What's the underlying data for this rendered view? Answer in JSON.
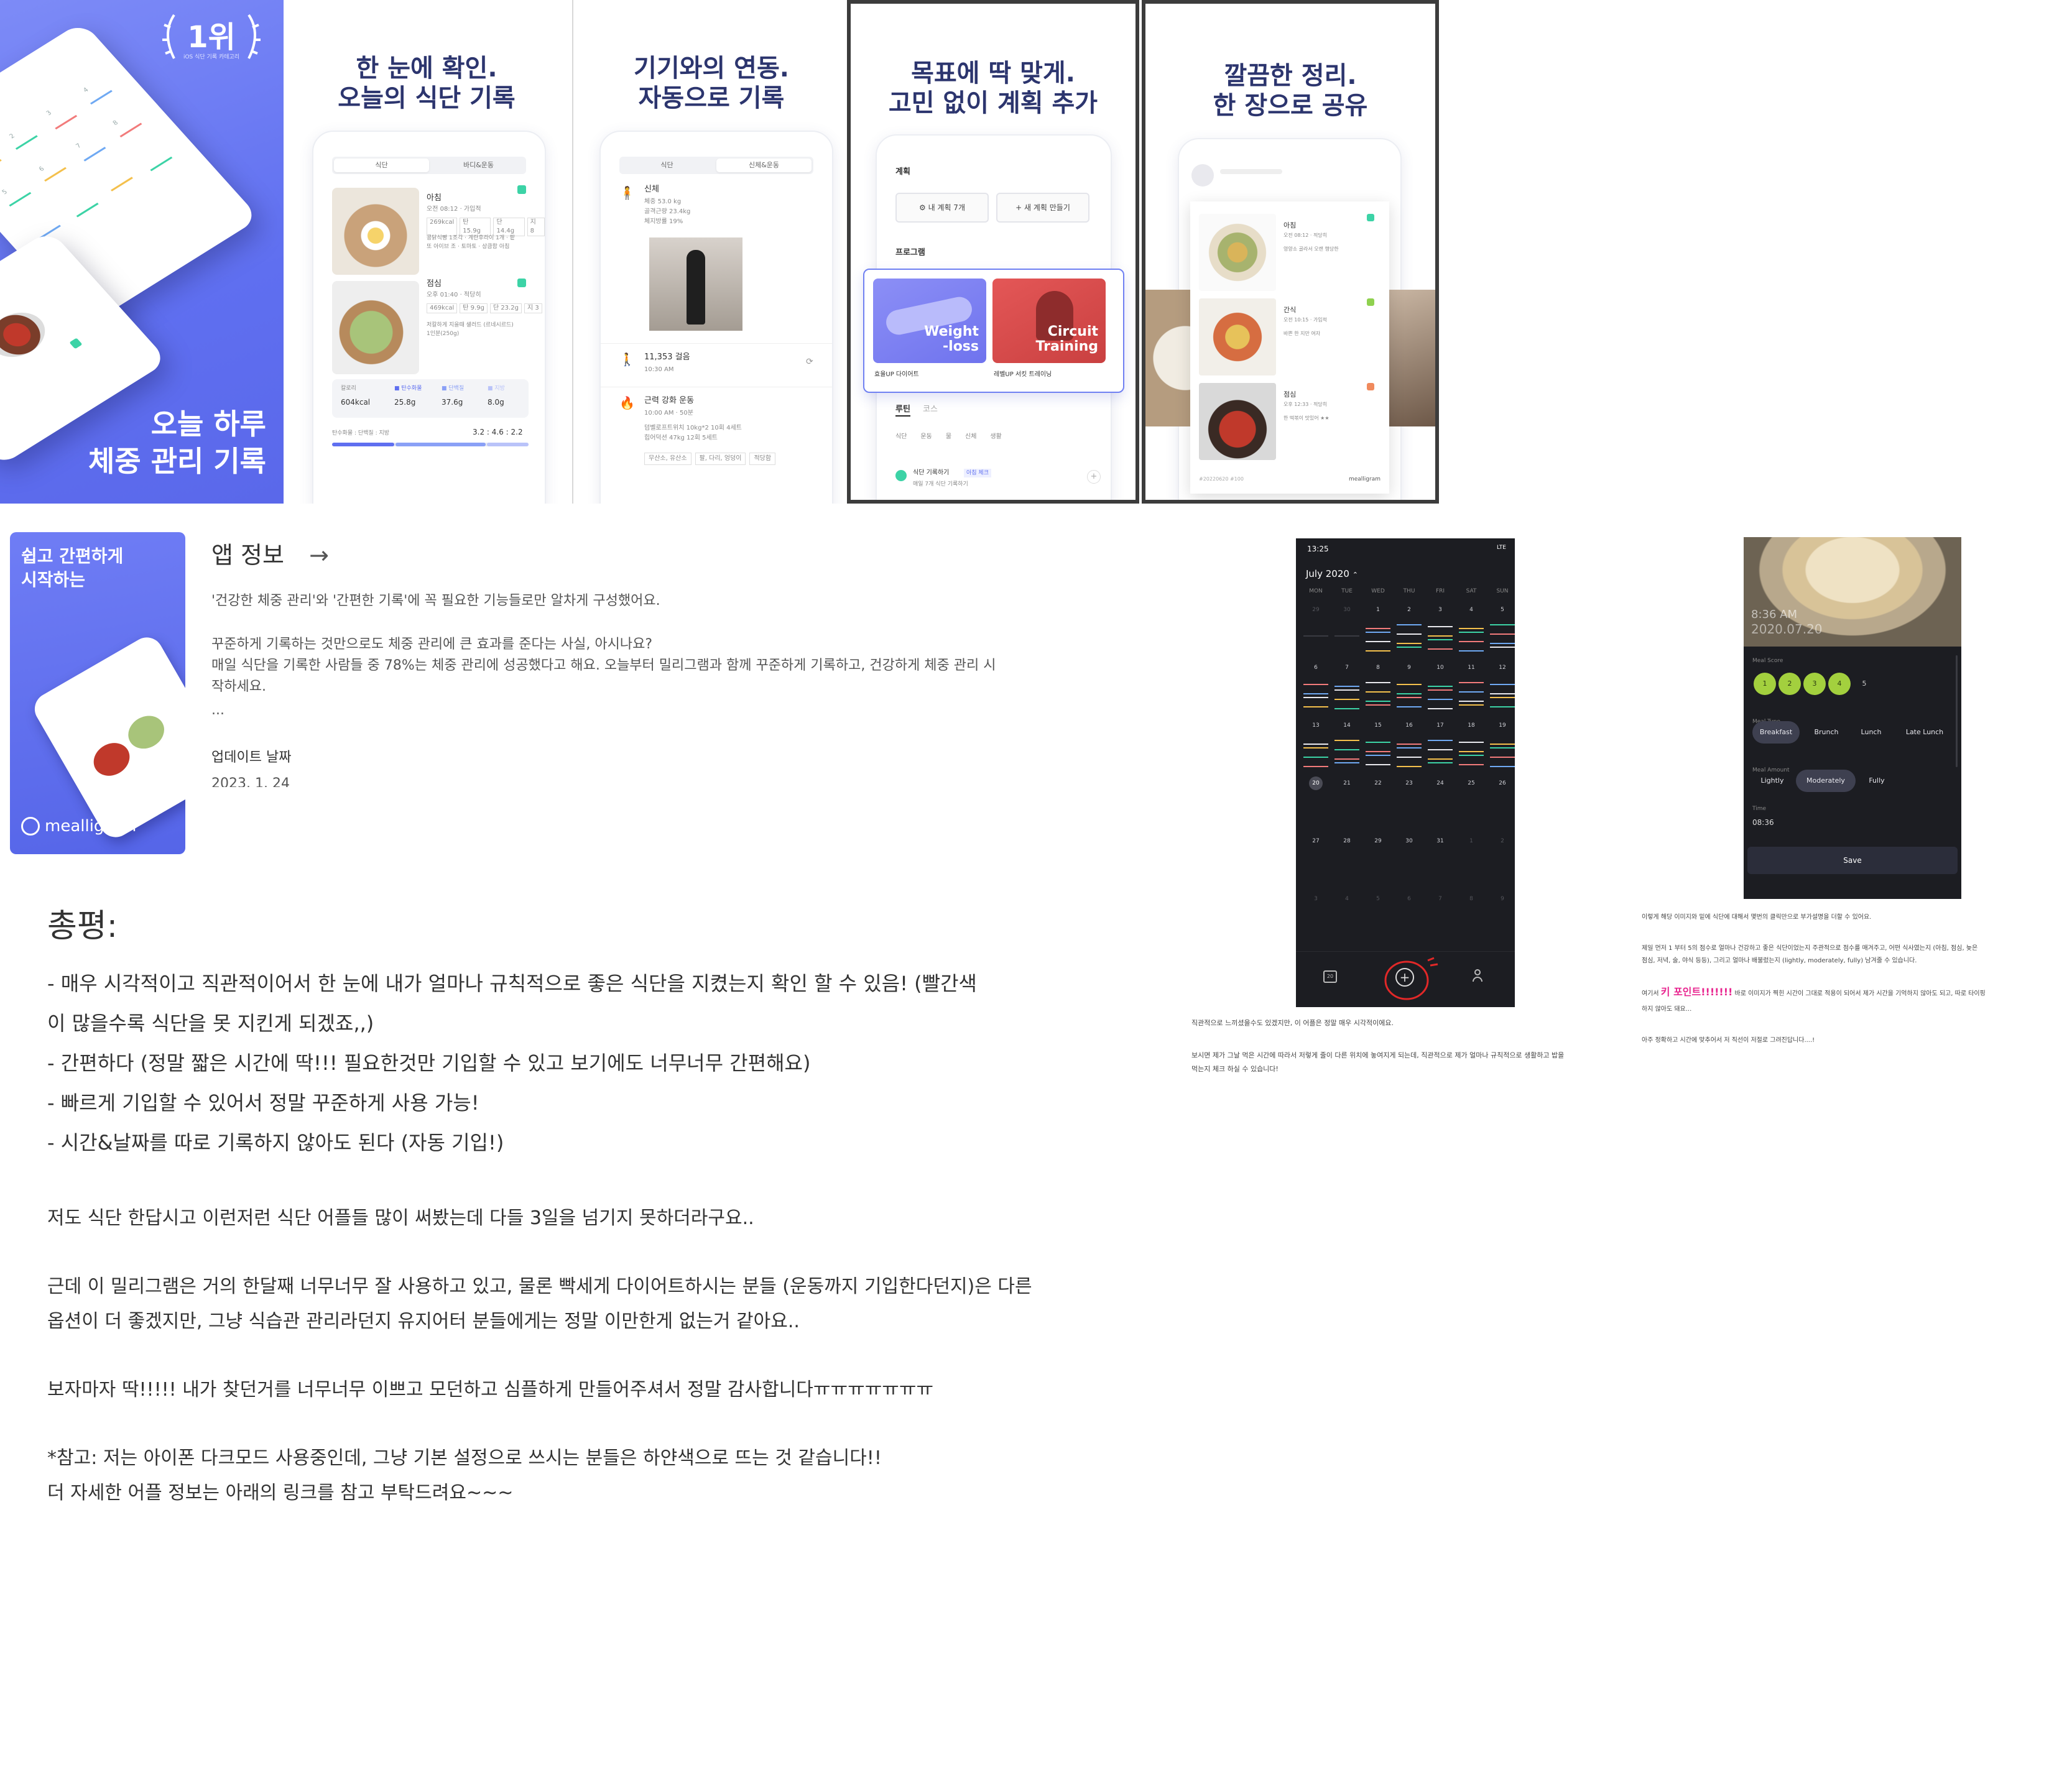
{
  "store": {
    "banner1": {
      "badge": "1위",
      "badge_sub": "iOS 식단 기록 카테고리",
      "title": "오늘 하루\n체중 관리 기록"
    },
    "banner2": {
      "title": "한 눈에 확인.\n오늘의 식단 기록",
      "tabs": [
        "식단",
        "바디&운동"
      ],
      "meal1": {
        "name": "아침",
        "time": "오전 08:12 · 가입적",
        "tags": [
          "269kcal",
          "탄 15.9g",
          "단 14.4g",
          "지 8"
        ],
        "memo": "콩닭식빵 1조각 · 계란후라이 1개 · 팥\n또 아이브 조 · 토마토 · 상큼함 아침"
      },
      "meal2": {
        "name": "점심",
        "time": "오후 01:40 · 적당히",
        "tags": [
          "469kcal",
          "탄 9.9g",
          "단 23.2g",
          "지 3"
        ],
        "memo": "저칼하게 지을때 샐러드 (르네시르드)\n1인분(250g)"
      },
      "kpis": [
        {
          "label": "칼로리",
          "value": "604kcal"
        },
        {
          "label": "■ 탄수화물",
          "value": "25.8g"
        },
        {
          "label": "■ 단백질",
          "value": "37.6g"
        },
        {
          "label": "■ 지방",
          "value": "8.0g"
        }
      ],
      "ratio_label": "탄수화물 : 단백질 : 지방",
      "ratio_value": "3.2 : 4.6 : 2.2"
    },
    "banner3": {
      "title": "기기와의 연동.\n자동으로 기록",
      "tabs": [
        "식단",
        "신체&운동"
      ],
      "body": {
        "name": "신체",
        "lines": [
          "체중 53.0 kg",
          "골격근량 23.4kg",
          "체지방률 19%"
        ]
      },
      "steps": {
        "name": "11,353 걸음",
        "time": "10:30 AM"
      },
      "workout": {
        "name": "근력 강화 운동",
        "time": "10:00 AM · 50분",
        "lines": [
          "덤벨로프트위치 10kg*2 10회 4세트",
          "힙어덕션 47kg 12회 5세트"
        ],
        "tags": [
          "무산소, 유산소",
          "팔, 다리, 엉덩이",
          "적당함"
        ]
      }
    },
    "banner4": {
      "title": "목표에 딱 맞게.\n고민 없이 계획 추가",
      "plan_heading": "계획",
      "buttons": [
        "내 계획 7개",
        "새 계획 만들기"
      ],
      "program_heading": "프로그램",
      "programs": [
        {
          "img_text": "Weight\n-loss",
          "caption": "효율UP 다이어트"
        },
        {
          "img_text": "Circuit\nTraining",
          "caption": "레벨UP 서킷 트레이닝"
        }
      ],
      "routine_tabs": [
        "루틴",
        "코스"
      ],
      "routine_chips": [
        "식단",
        "운동",
        "물",
        "신체",
        "생활"
      ],
      "routine_item": "식단 기록하기",
      "routine_badge": "아침 체크",
      "routine_sub": "매일 7개 식단 기록하기"
    },
    "banner5": {
      "title": "깔끔한 정리.\n한 장으로 공유",
      "meals": [
        {
          "name": "아침",
          "time": "오전 08:12 · 적당히",
          "memo": "영양소 골라서 오랜 행당한"
        },
        {
          "name": "간식",
          "time": "오전 10:15 · 가입적",
          "memo": "바쁜 한 지만 여자"
        },
        {
          "name": "점심",
          "time": "오후 12:33 · 적당히",
          "memo": "한 떡볶이 맛있어 ★★"
        }
      ],
      "footer_date": "#20220620 #100",
      "footer_logo": "mealligram"
    }
  },
  "appinfo": {
    "icon_tagline": "쉽고 간편하게\n시작하는",
    "icon_logo": "mealligram",
    "title": "앱 정보",
    "arrow": "→",
    "p1": "'건강한 체중 관리'와 '간편한 기록'에 꼭 필요한 기능들로만 알차게 구성했어요.",
    "p2": "꾸준하게 기록하는 것만으로도 체중 관리에 큰 효과를 준다는 사실, 아시나요?",
    "p3": "매일 식단을 기록한 사람들 중 78%는 체중 관리에 성공했다고 해요. 오늘부터 밀리그램과 함께 꾸준하게 기록하고, 건강하게 체중 관리 시",
    "p4": "작하세요.",
    "ellipsis": "...",
    "update_label": "업데이트 날짜",
    "update_value": "2023. 1. 24"
  },
  "review": {
    "heading": "총평:",
    "bullets": [
      "- 매우 시각적이고 직관적이어서 한 눈에 내가 얼마나 규칙적으로 좋은 식단을 지켰는지 확인 할 수 있음! (빨간색",
      "이 많을수록 식단을 못 지킨게 되겠죠,,)",
      "- 간편하다 (정말 짧은 시간에 딱!!! 필요한것만 기입할 수 있고 보기에도 너무너무 간편해요)",
      "- 빠르게 기입할 수 있어서 정말 꾸준하게 사용 가능!",
      "- 시간&날짜를 따로 기록하지 않아도 된다 (자동 기입!)"
    ],
    "para1": "저도 식단 한답시고 이런저런 식단 어플들 많이 써봤는데 다들 3일을 넘기지 못하더라구요..",
    "para2a": "근데 이 밀리그램은 거의 한달째 너무너무 잘 사용하고 있고, 물론 빡세게 다이어트하시는 분들 (운동까지 기입한다던지)은 다른",
    "para2b": "옵션이 더 좋겠지만, 그냥 식습관 관리라던지 유지어터 분들에게는 정말 이만한게 없는거 같아요..",
    "para3": "보자마자 딱!!!!! 내가 찾던거를 너무너무 이쁘고 모던하고 심플하게 만들어주셔서 정말 감사합니다ㅠㅠㅠㅠㅠㅠㅠ",
    "note1": "*참고: 저는 아이폰 다크모드 사용중인데, 그냥 기본 설정으로 쓰시는 분들은 하얀색으로 뜨는 것 같습니다!!",
    "note2": "더 자세한 어플 정보는 아래의 링크를 참고 부탁드려요~~~"
  },
  "calendar": {
    "status_time": "13:25",
    "status_right": "LTE",
    "month": "July 2020",
    "weekdays": [
      "MON",
      "TUE",
      "WED",
      "THU",
      "FRI",
      "SAT",
      "SUN"
    ],
    "weeks": [
      [
        "29",
        "30",
        "1",
        "2",
        "3",
        "4",
        "5"
      ],
      [
        "6",
        "7",
        "8",
        "9",
        "10",
        "11",
        "12"
      ],
      [
        "13",
        "14",
        "15",
        "16",
        "17",
        "18",
        "19"
      ],
      [
        "20",
        "21",
        "22",
        "23",
        "24",
        "25",
        "26"
      ],
      [
        "27",
        "28",
        "29",
        "30",
        "31",
        "1",
        "2"
      ],
      [
        "3",
        "4",
        "5",
        "6",
        "7",
        "8",
        "9"
      ]
    ],
    "today": "20",
    "caption1": "직관적으로 느끼셨을수도 있겠지만, 이 어플은 정말 매우 시각적이에요.",
    "caption2": "보시면 제가 그날 먹은 시간에 따라서 저렇게 줄이 다른 위치에 놓여지게 되는데, 직관적으로 제가 얼마나 규칙적으로 생활하고 밥을",
    "caption3": "먹는지 체크 하실 수 있습니다!"
  },
  "meal_edit": {
    "photo_time": "8:36 AM",
    "photo_date": "2020.07.20",
    "score_label": "Meal Score",
    "scores": [
      "1",
      "2",
      "3",
      "4",
      "5"
    ],
    "type_label": "Meal Type",
    "types": [
      "Breakfast",
      "Brunch",
      "Lunch",
      "Late Lunch"
    ],
    "amount_label": "Meal Amount",
    "amounts": [
      "Lightly",
      "Moderately",
      "Fully"
    ],
    "time_label": "Time",
    "time_value": "08:36",
    "save": "Save",
    "caption1": "이렇게 해당 이미지와 밑에 식단에 대해서 몇번의 클릭만으로 부가설명을 더할 수 있어요.",
    "caption2": "제일 먼저 1 부터 5의 점수로 얼마나 건강하고 좋은 식단이었는지 주관적으로 점수를 매겨주고, 어떤 식사였는지 (아침, 점심, 늦은",
    "caption3": "점심, 저녁, 술, 야식 등등), 그리고 얼마나 배불렀는지 (lightly, moderately, fully) 남겨줄 수 있습니다.",
    "caption4a": "여기서 ",
    "caption4_hl": "키 포인트!!!!!!!",
    "caption4b": " 바로 이미지가 찍힌 시간이 그대로 적용이 되어서 제가 시간을 기억하지 않아도 되고, 따로 타이핑",
    "caption5": "하지 않아도 돼요...",
    "caption6": "아주 정확하고 시간에 맞추어서 저 직선이 저절로 그려진답니다....!"
  },
  "colors": {
    "brand": "#5f6ff0",
    "headline": "#2c356e",
    "score_green": "#a3d03e",
    "highlight": "#e8258f"
  }
}
